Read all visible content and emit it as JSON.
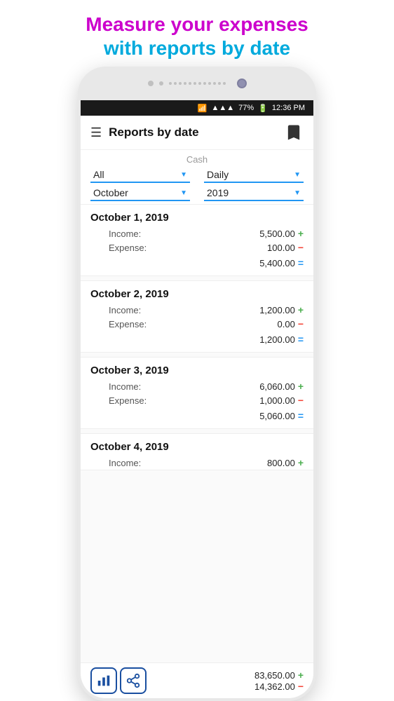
{
  "header": {
    "line1": "Measure your expenses",
    "line2": "with reports by date"
  },
  "status_bar": {
    "wifi": "WiFi",
    "signal": "▲▲▲",
    "battery": "77%",
    "time": "12:36 PM"
  },
  "app_bar": {
    "title": "Reports by date"
  },
  "filters": {
    "cash_label": "Cash",
    "row1": {
      "left": "All",
      "right": "Daily"
    },
    "row2": {
      "left": "October",
      "right": "2019"
    }
  },
  "sections": [
    {
      "date": "October 1,  2019",
      "income_label": "Income:",
      "income_value": "5,500.00",
      "expense_label": "Expense:",
      "expense_value": "100.00",
      "total": "5,400.00"
    },
    {
      "date": "October 2,  2019",
      "income_label": "Income:",
      "income_value": "1,200.00",
      "expense_label": "Expense:",
      "expense_value": "0.00",
      "total": "1,200.00"
    },
    {
      "date": "October 3,  2019",
      "income_label": "Income:",
      "income_value": "6,060.00",
      "expense_label": "Expense:",
      "expense_value": "1,000.00",
      "total": "5,060.00"
    },
    {
      "date": "October 4,  2019",
      "income_label": "Income:",
      "income_value": "800.00",
      "expense_label": "Expense:",
      "expense_value": "",
      "total": ""
    }
  ],
  "bottom": {
    "total1_value": "83,650.00",
    "total2_value": "14,362.00"
  },
  "signs": {
    "plus": "+",
    "minus": "−",
    "equals": "="
  }
}
